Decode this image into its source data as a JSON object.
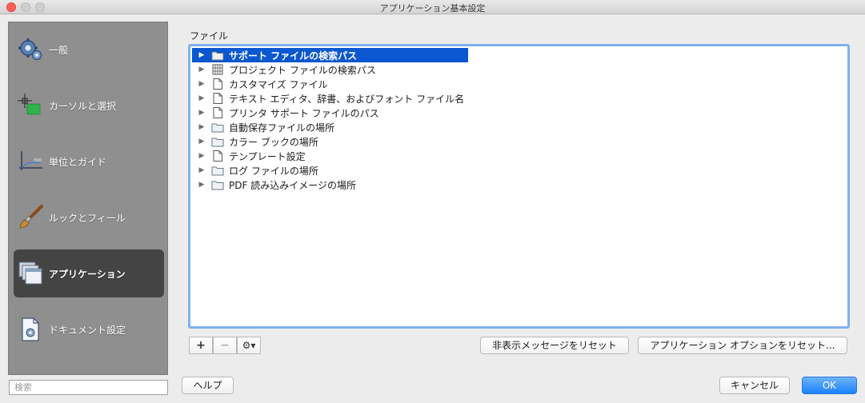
{
  "window": {
    "title": "アプリケーション基本設定"
  },
  "sidebar": {
    "items": [
      {
        "label": "一般",
        "icon": "gear-icon",
        "selected": false
      },
      {
        "label": "カーソルと選択",
        "icon": "cursor-select-icon",
        "selected": false
      },
      {
        "label": "単位とガイド",
        "icon": "ruler-guide-icon",
        "selected": false
      },
      {
        "label": "ルックとフィール",
        "icon": "brush-icon",
        "selected": false
      },
      {
        "label": "アプリケーション",
        "icon": "windows-icon",
        "selected": true
      },
      {
        "label": "ドキュメント設定",
        "icon": "document-settings-icon",
        "selected": false
      }
    ],
    "search_placeholder": "検索"
  },
  "main": {
    "section_label": "ファイル",
    "tree": [
      {
        "label": "サポート ファイルの検索パス",
        "icon": "folder-icon",
        "selected": true
      },
      {
        "label": "プロジェクト ファイルの検索パス",
        "icon": "project-file-icon",
        "selected": false
      },
      {
        "label": "カスタマイズ ファイル",
        "icon": "file-icon",
        "selected": false
      },
      {
        "label": "テキスト エディタ、辞書、およびフォント ファイル名",
        "icon": "file-icon",
        "selected": false
      },
      {
        "label": "プリンタ サポート ファイルのパス",
        "icon": "file-icon",
        "selected": false
      },
      {
        "label": "自動保存ファイルの場所",
        "icon": "folder-icon",
        "selected": false
      },
      {
        "label": "カラー ブックの場所",
        "icon": "folder-icon",
        "selected": false
      },
      {
        "label": "テンプレート設定",
        "icon": "file-icon",
        "selected": false
      },
      {
        "label": "ログ ファイルの場所",
        "icon": "folder-icon",
        "selected": false
      },
      {
        "label": "PDF 読み込みイメージの場所",
        "icon": "folder-icon",
        "selected": false
      }
    ]
  },
  "toolbar": {
    "add_label": "+",
    "remove_label": "−",
    "gear_label": "⚙▾",
    "reset_messages_label": "非表示メッセージをリセット",
    "reset_options_label": "アプリケーション オプションをリセット..."
  },
  "footer": {
    "help_label": "ヘルプ",
    "cancel_label": "キャンセル",
    "ok_label": "OK"
  },
  "colors": {
    "accent": "#0a57cf",
    "focus_ring": "#7db1ec",
    "primary_button": "#1a82fb",
    "sidebar_bg": "#8f8f8f",
    "sidebar_selected": "#444444"
  }
}
